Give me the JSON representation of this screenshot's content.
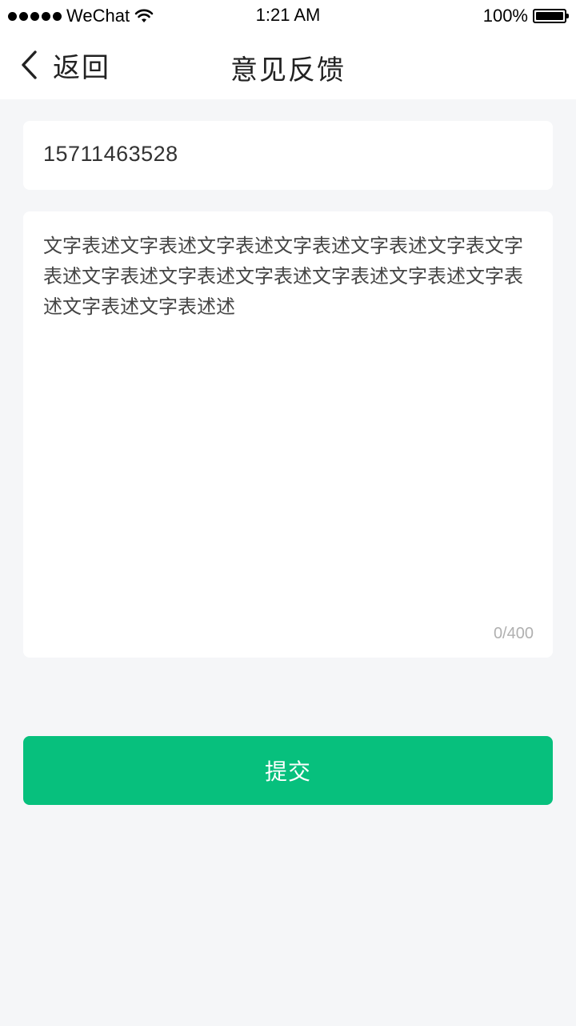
{
  "status_bar": {
    "carrier": "WeChat",
    "time": "1:21 AM",
    "battery_percent": "100%",
    "battery_level": 1.0
  },
  "nav": {
    "back_label": "返回",
    "title": "意见反馈"
  },
  "form": {
    "phone_value": "15711463528",
    "feedback_value": "文字表述文字表述文字表述文字表述文字表述文字表文字表述文字表述文字表述文字表述文字表述文字表述文字表述文字表述文字表述述",
    "char_count": "0/400"
  },
  "submit": {
    "label": "提交",
    "color": "#07c07d"
  },
  "colors": {
    "background": "#f5f6f8",
    "card": "#ffffff",
    "accent": "#07c07d"
  }
}
